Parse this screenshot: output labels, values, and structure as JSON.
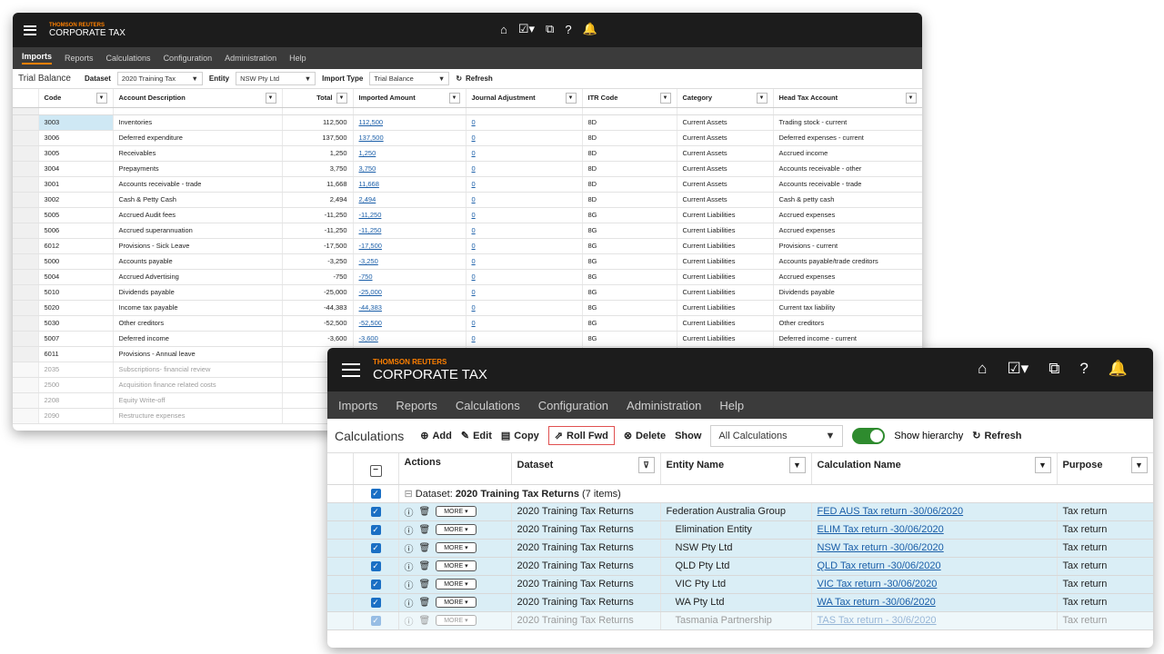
{
  "brand": {
    "line1": "THOMSON REUTERS",
    "line2": "CORPORATE TAX"
  },
  "icons": {
    "home": "⌂",
    "tasks": "☑▾",
    "chat": "⧉",
    "help": "?",
    "bell": "🔔"
  },
  "win1": {
    "nav": [
      "Imports",
      "Reports",
      "Calculations",
      "Configuration",
      "Administration",
      "Help"
    ],
    "title": "Trial Balance",
    "dataset_label": "Dataset",
    "dataset_value": "2020 Training Tax",
    "entity_label": "Entity",
    "entity_value": "NSW Pty Ltd",
    "import_type_label": "Import Type",
    "import_type_value": "Trial Balance",
    "refresh_label": "Refresh",
    "columns": [
      "Code",
      "Account Description",
      "Total",
      "Imported Amount",
      "Journal Adjustment",
      "ITR Code",
      "Category",
      "Head Tax Account"
    ],
    "rows": [
      [
        "3003",
        "Inventories",
        "112,500",
        "112,500",
        "0",
        "8D",
        "Current Assets",
        "Trading stock - current"
      ],
      [
        "3006",
        "Deferred expenditure",
        "137,500",
        "137,500",
        "0",
        "8D",
        "Current Assets",
        "Deferred expenses - current"
      ],
      [
        "3005",
        "Receivables",
        "1,250",
        "1,250",
        "0",
        "8D",
        "Current Assets",
        "Accrued income"
      ],
      [
        "3004",
        "Prepayments",
        "3,750",
        "3,750",
        "0",
        "8D",
        "Current Assets",
        "Accounts receivable - other"
      ],
      [
        "3001",
        "Accounts receivable - trade",
        "11,668",
        "11,668",
        "0",
        "8D",
        "Current Assets",
        "Accounts receivable - trade"
      ],
      [
        "3002",
        "Cash & Petty Cash",
        "2,494",
        "2,494",
        "0",
        "8D",
        "Current Assets",
        "Cash & petty cash"
      ],
      [
        "5005",
        "Accrued Audit fees",
        "-11,250",
        "-11,250",
        "0",
        "8G",
        "Current Liabilities",
        "Accrued expenses"
      ],
      [
        "5006",
        "Accrued superannuation",
        "-11,250",
        "-11,250",
        "0",
        "8G",
        "Current Liabilities",
        "Accrued expenses"
      ],
      [
        "6012",
        "Provisions - Sick Leave",
        "-17,500",
        "-17,500",
        "0",
        "8G",
        "Current Liabilities",
        "Provisions - current"
      ],
      [
        "5000",
        "Accounts payable",
        "-3,250",
        "-3,250",
        "0",
        "8G",
        "Current Liabilities",
        "Accounts payable/trade creditors"
      ],
      [
        "5004",
        "Accrued Advertising",
        "-750",
        "-750",
        "0",
        "8G",
        "Current Liabilities",
        "Accrued expenses"
      ],
      [
        "5010",
        "Dividends payable",
        "-25,000",
        "-25,000",
        "0",
        "8G",
        "Current Liabilities",
        "Dividends payable"
      ],
      [
        "5020",
        "Income tax payable",
        "-44,383",
        "-44,383",
        "0",
        "8G",
        "Current Liabilities",
        "Current tax liability"
      ],
      [
        "5030",
        "Other creditors",
        "-52,500",
        "-52,500",
        "0",
        "8G",
        "Current Liabilities",
        "Other creditors"
      ],
      [
        "5007",
        "Deferred income",
        "-3,600",
        "-3,600",
        "0",
        "8G",
        "Current Liabilities",
        "Deferred income - current"
      ],
      [
        "6011",
        "Provisions - Annual leave",
        "",
        "",
        "",
        "",
        "",
        ""
      ],
      [
        "2035",
        "Subscriptions- financial review",
        "",
        "",
        "",
        "",
        "",
        ""
      ],
      [
        "2500",
        "Acquisition finance related costs",
        "",
        "",
        "",
        "",
        "",
        ""
      ],
      [
        "2208",
        "Equity Write-off",
        "",
        "",
        "",
        "",
        "",
        ""
      ],
      [
        "2090",
        "Restructure expenses",
        "",
        "",
        "",
        "",
        "",
        ""
      ]
    ]
  },
  "win2": {
    "nav": [
      "Imports",
      "Reports",
      "Calculations",
      "Configuration",
      "Administration",
      "Help"
    ],
    "title": "Calculations",
    "add": "Add",
    "edit": "Edit",
    "copy": "Copy",
    "rollfwd": "Roll Fwd",
    "delete": "Delete",
    "show_label": "Show",
    "show_value": "All Calculations",
    "hierarchy_label": "Show hierarchy",
    "refresh_label": "Refresh",
    "columns": [
      "Actions",
      "Dataset",
      "Entity Name",
      "Calculation Name",
      "Purpose"
    ],
    "group_prefix": "Dataset:",
    "group_name": "2020 Training Tax Returns",
    "group_count": "(7 items)",
    "more_label": "MORE ▾",
    "rows": [
      [
        "2020 Training Tax Returns",
        "Federation Australia Group",
        "FED AUS Tax return -30/06/2020",
        "Tax return"
      ],
      [
        "2020 Training Tax Returns",
        "Elimination Entity",
        "ELIM Tax return -30/06/2020",
        "Tax return"
      ],
      [
        "2020 Training Tax Returns",
        "NSW Pty Ltd",
        "NSW Tax return -30/06/2020",
        "Tax return"
      ],
      [
        "2020 Training Tax Returns",
        "QLD Pty Ltd",
        "QLD Tax return -30/06/2020",
        "Tax return"
      ],
      [
        "2020 Training Tax Returns",
        "VIC Pty Ltd",
        "VIC Tax return -30/06/2020",
        "Tax return"
      ],
      [
        "2020 Training Tax Returns",
        "WA Pty Ltd",
        "WA Tax return -30/06/2020",
        "Tax return"
      ],
      [
        "2020 Training Tax Returns",
        "Tasmania Partnership",
        "TAS Tax return - 30/6/2020",
        "Tax return"
      ]
    ]
  }
}
